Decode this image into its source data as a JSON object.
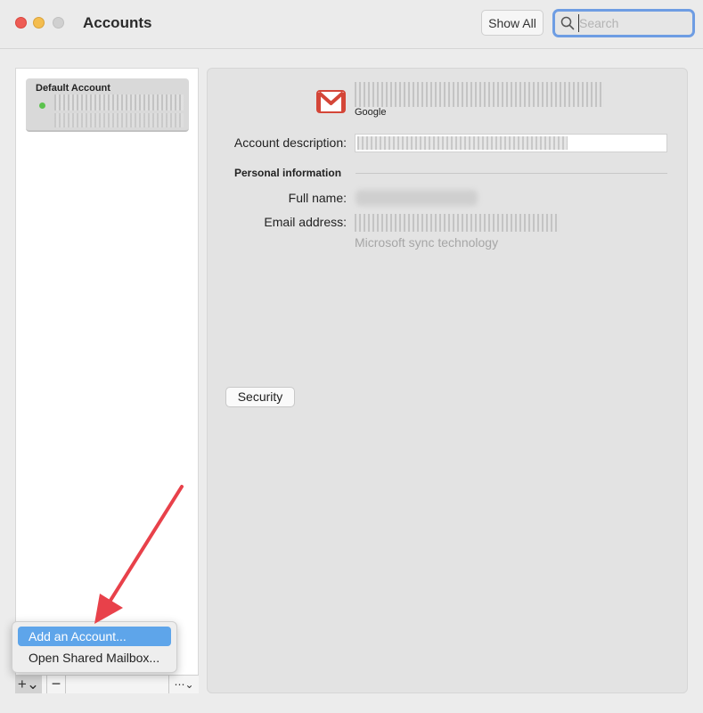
{
  "window": {
    "title": "Accounts",
    "show_all_label": "Show All",
    "search_placeholder": "Search"
  },
  "sidebar": {
    "accounts": [
      {
        "name": "Default Account",
        "status": "online",
        "status_color": "#5bc24d"
      }
    ]
  },
  "bottom_bar": {
    "add_label": "+⌄",
    "remove_label": "−",
    "more_label": "⋯⌄"
  },
  "add_menu": {
    "items": [
      {
        "label": "Add an Account...",
        "selected": true
      },
      {
        "label": "Open Shared Mailbox...",
        "selected": false
      }
    ]
  },
  "detail": {
    "provider": "Google",
    "provider_icon": "gmail-icon",
    "account_description_label": "Account description:",
    "personal_info_title": "Personal information",
    "full_name_label": "Full name:",
    "email_label": "Email address:",
    "sync_note": "Microsoft sync technology",
    "security_button": "Security"
  },
  "colors": {
    "accent": "#5ea5ea",
    "search_focus": "#6e9de3",
    "arrow": "#e8414a",
    "gmail_red": "#d44638"
  }
}
